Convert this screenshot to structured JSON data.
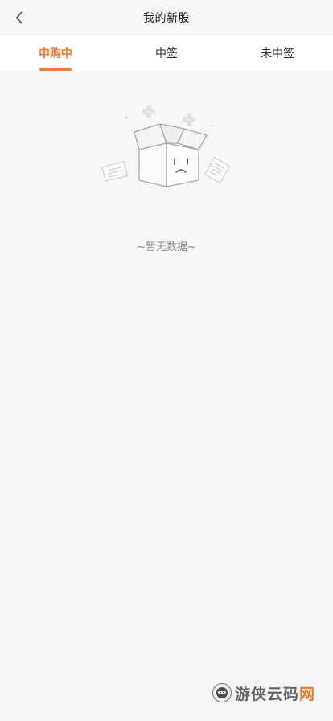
{
  "nav": {
    "title": "我的新股"
  },
  "tabs": [
    {
      "label": "申购中",
      "active": true
    },
    {
      "label": "中签",
      "active": false
    },
    {
      "label": "未中签",
      "active": false
    }
  ],
  "empty_state": {
    "message": "~暂无数据~"
  },
  "watermark": {
    "text_main": "游侠云码",
    "text_accent": "网"
  },
  "colors": {
    "accent": "#ee7b2e",
    "background": "#f6f6f6",
    "text_primary": "#222222",
    "text_muted": "#888888"
  },
  "icons": {
    "back": "chevron-left-icon",
    "empty": "empty-box-icon",
    "watermark": "ninja-logo-icon"
  }
}
